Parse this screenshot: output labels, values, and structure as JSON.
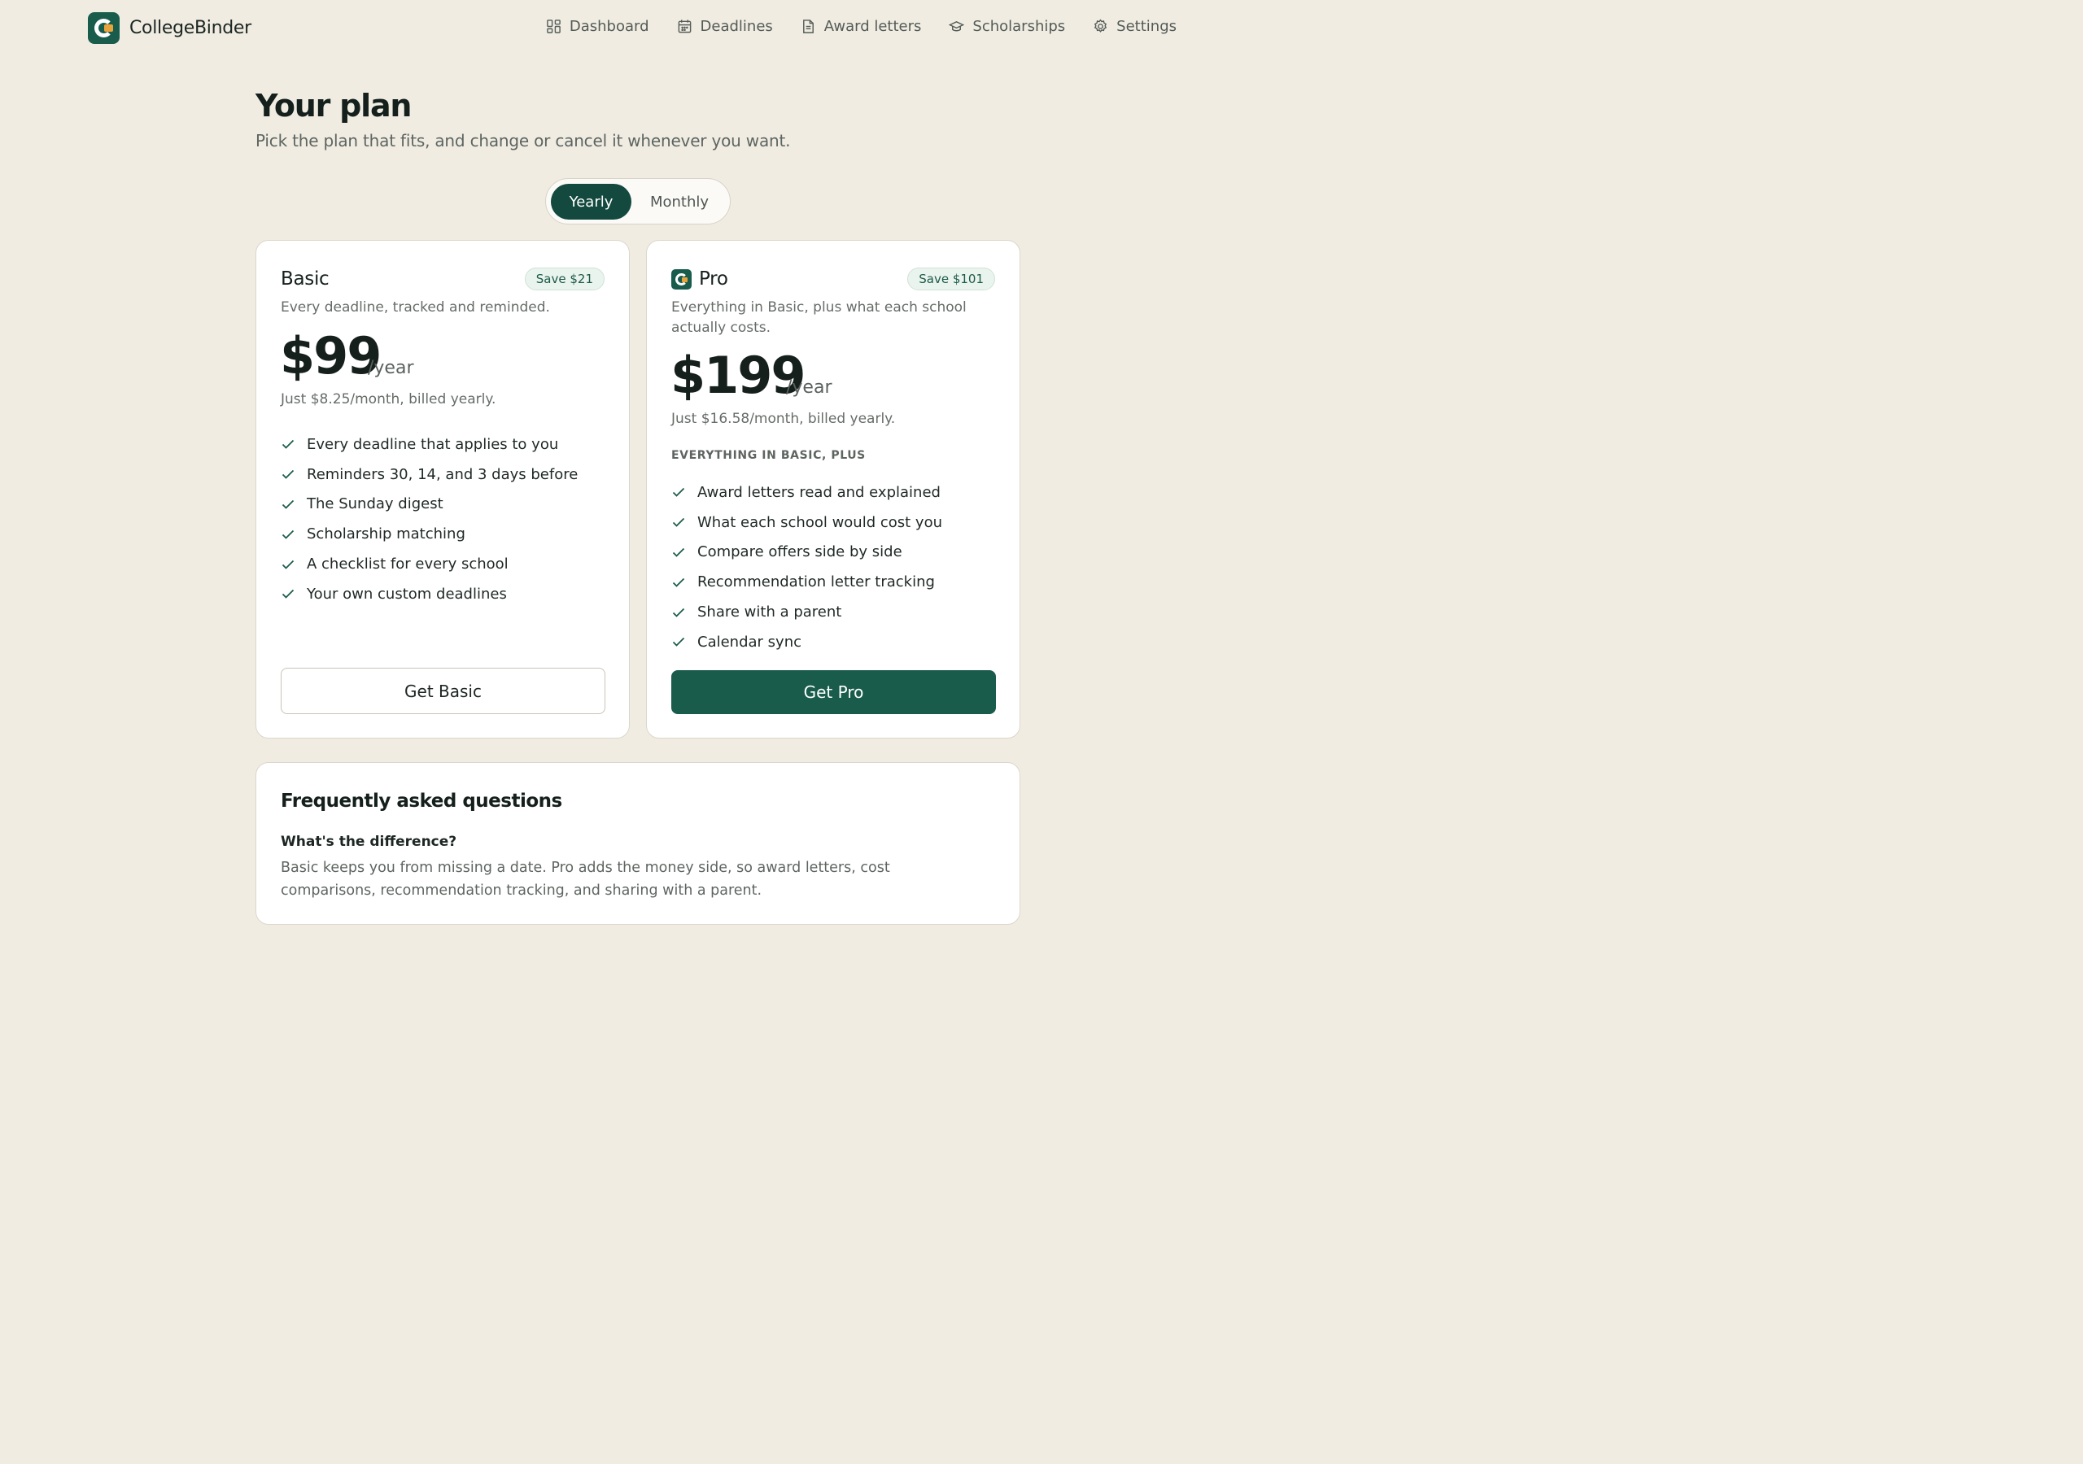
{
  "brand": {
    "name": "CollegeBinder"
  },
  "nav": {
    "items": [
      {
        "label": "Dashboard",
        "icon": "dashboard-icon"
      },
      {
        "label": "Deadlines",
        "icon": "calendar-icon"
      },
      {
        "label": "Award letters",
        "icon": "document-icon"
      },
      {
        "label": "Scholarships",
        "icon": "graduation-cap-icon"
      },
      {
        "label": "Settings",
        "icon": "gear-icon"
      }
    ]
  },
  "header": {
    "title": "Your plan",
    "subtitle": "Pick the plan that fits, and change or cancel it whenever you want."
  },
  "billing_toggle": {
    "options": [
      "Yearly",
      "Monthly"
    ],
    "selected": "Yearly"
  },
  "plans": {
    "basic": {
      "name": "Basic",
      "badge": "Save $21",
      "description": "Every deadline, tracked and reminded.",
      "price": "$99",
      "period": "/year",
      "billing_note": "Just $8.25/month, billed yearly.",
      "features": [
        "Every deadline that applies to you",
        "Reminders 30, 14, and 3 days before",
        "The Sunday digest",
        "Scholarship matching",
        "A checklist for every school",
        "Your own custom deadlines"
      ],
      "cta": "Get Basic"
    },
    "pro": {
      "name": "Pro",
      "badge": "Save $101",
      "description": "Everything in Basic, plus what each school actually costs.",
      "price": "$199",
      "period": "/year",
      "billing_note": "Just $16.58/month, billed yearly.",
      "section_label": "EVERYTHING IN BASIC, PLUS",
      "features": [
        "Award letters read and explained",
        "What each school would cost you",
        "Compare offers side by side",
        "Recommendation letter tracking",
        "Share with a parent",
        "Calendar sync"
      ],
      "cta": "Get Pro"
    }
  },
  "faq": {
    "title": "Frequently asked questions",
    "question": "What's the difference?",
    "answer": "Basic keeps you from missing a date. Pro adds the money side, so award letters, cost comparisons, recommendation tracking, and sharing with a parent."
  },
  "colors": {
    "accent": "#1a5c4c",
    "toggle_active": "#13493e",
    "background": "#f0ece2",
    "brand_dot": "#e8a43a"
  }
}
